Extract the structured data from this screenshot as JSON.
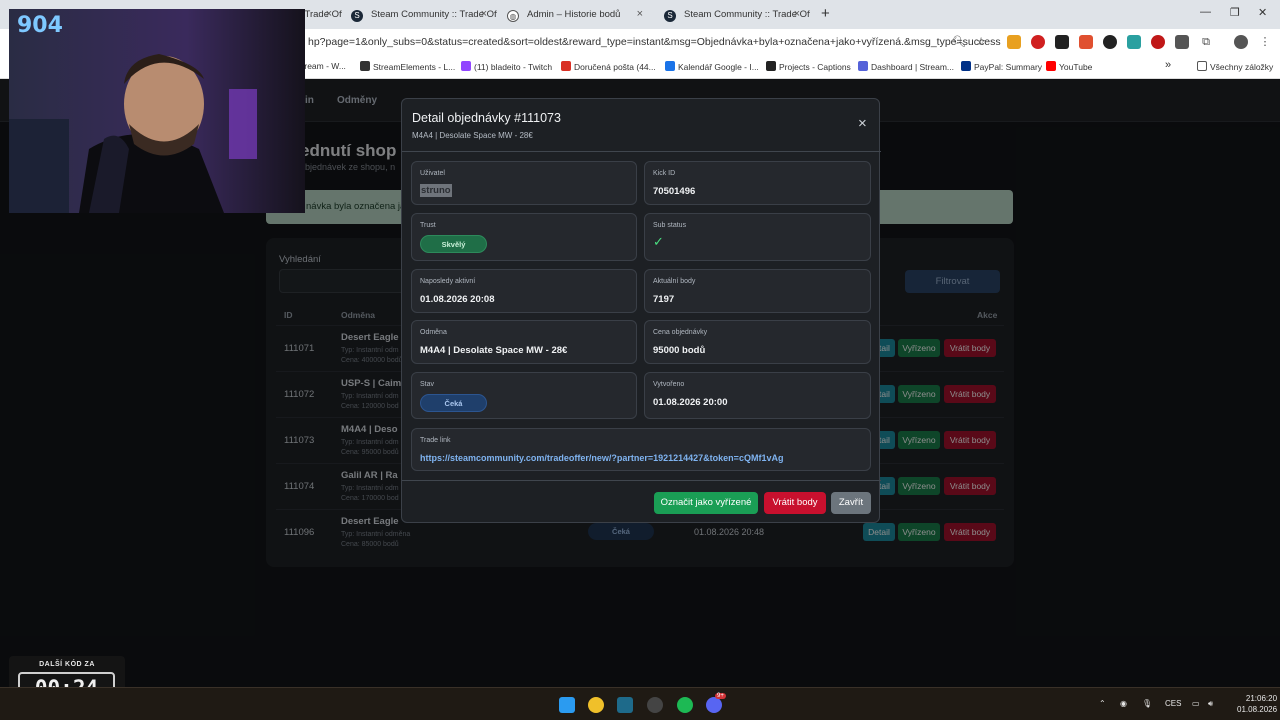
{
  "browser": {
    "tabs": [
      {
        "label": "Steam Community :: Trade Offe",
        "icon": "steam-icon"
      },
      {
        "label": "Admin – Historie bodů",
        "icon": "globe-icon"
      },
      {
        "label": "Steam Community :: Trade Offe",
        "icon": "steam-icon"
      }
    ],
    "url": "hp?page=1&only_subs=0&status=created&sort=oldest&reward_type=instant&msg=Objednávka+byla+označena+jako+vyřízená.&msg_type=success",
    "bookmarks": [
      {
        "label": "tream - W..."
      },
      {
        "label": "StreamElements - L..."
      },
      {
        "label": "(11) bladeito - Twitch"
      },
      {
        "label": "Doručená pošta (44..."
      },
      {
        "label": "Kalendář Google - I..."
      },
      {
        "label": "Projects - Captions"
      },
      {
        "label": "Dashboard | Stream..."
      },
      {
        "label": "PayPal: Summary"
      },
      {
        "label": "YouTube"
      }
    ],
    "bookmarks_more": "»",
    "all_bookmarks": "Všechny záložky"
  },
  "page": {
    "nav": {
      "item1": "in",
      "item2": "Odměny"
    },
    "title": "ednutí shop",
    "subtitle": "objednávek ze shopu, n",
    "alert": "návka byla označena ja",
    "search_label": "Vyhledání",
    "filter_button": "Filtrovat",
    "table_headers": {
      "id": "ID",
      "reward": "Odměna",
      "actions": "Akce"
    },
    "rows": [
      {
        "id": "111071",
        "name": "Desert Eagle",
        "type": "Typ: Instantní odm",
        "price": "Cena: 400000 bodů",
        "status": "",
        "date": ""
      },
      {
        "id": "111072",
        "name": "USP-S | Caim",
        "type": "Typ: Instantní odm",
        "price": "Cena: 120000 bod",
        "status": "",
        "date": ""
      },
      {
        "id": "111073",
        "name": "M4A4 | Deso",
        "type": "Typ: Instantní odm",
        "price": "Cena: 95000 bodů",
        "status": "",
        "date": ""
      },
      {
        "id": "111074",
        "name": "Galil AR | Ra",
        "type": "Typ: Instantní odm",
        "price": "Cena: 170000 bod",
        "status": "",
        "date": ""
      },
      {
        "id": "111096",
        "name": "Desert Eagle",
        "type": "Typ: Instantní odměna",
        "price": "Cena: 85000 bodů",
        "status": "Čeká",
        "date": "01.08.2026 20:48"
      }
    ],
    "row_buttons": {
      "detail": "Detail",
      "done": "Vyřízeno",
      "refund": "Vrátit body"
    }
  },
  "modal": {
    "title": "Detail objednávky #111073",
    "subtitle": "M4A4 | Desolate Space MW - 28€",
    "close": "×",
    "fields": {
      "user_label": "Uživatel",
      "user_value": "struno",
      "kick_label": "Kick ID",
      "kick_value": "70501496",
      "trust_label": "Trust",
      "trust_value": "Skvělý",
      "sub_label": "Sub status",
      "sub_value": "✓",
      "last_label": "Naposledy aktivní",
      "last_value": "01.08.2026 20:08",
      "points_label": "Aktuální body",
      "points_value": "7197",
      "reward_label": "Odměna",
      "reward_value": "M4A4 | Desolate Space MW - 28€",
      "price_label": "Cena objednávky",
      "price_value": "95000 bodů",
      "status_label": "Stav",
      "status_value": "Čeká",
      "created_label": "Vytvořeno",
      "created_value": "01.08.2026 20:00",
      "trade_label": "Trade link",
      "trade_value": "https://steamcommunity.com/tradeoffer/new/?partner=1921214427&token=cQMf1vAg"
    },
    "buttons": {
      "mark_done": "Označit jako vyřízené",
      "refund": "Vrátit body",
      "close": "Zavřít"
    }
  },
  "overlay": {
    "counter": "904",
    "timer_label": "DALŠÍ KÓD ZA",
    "timer_value": "00:24"
  },
  "taskbar": {
    "language": "CES",
    "time": "21:06:20",
    "date": "01.08.2026",
    "discord_badge": "9+"
  },
  "colors": {
    "success": "#1a9e55",
    "danger": "#c8102e",
    "info": "#1d8a9e",
    "trust": "#1f6e47",
    "pending": "#1f3f6b"
  }
}
